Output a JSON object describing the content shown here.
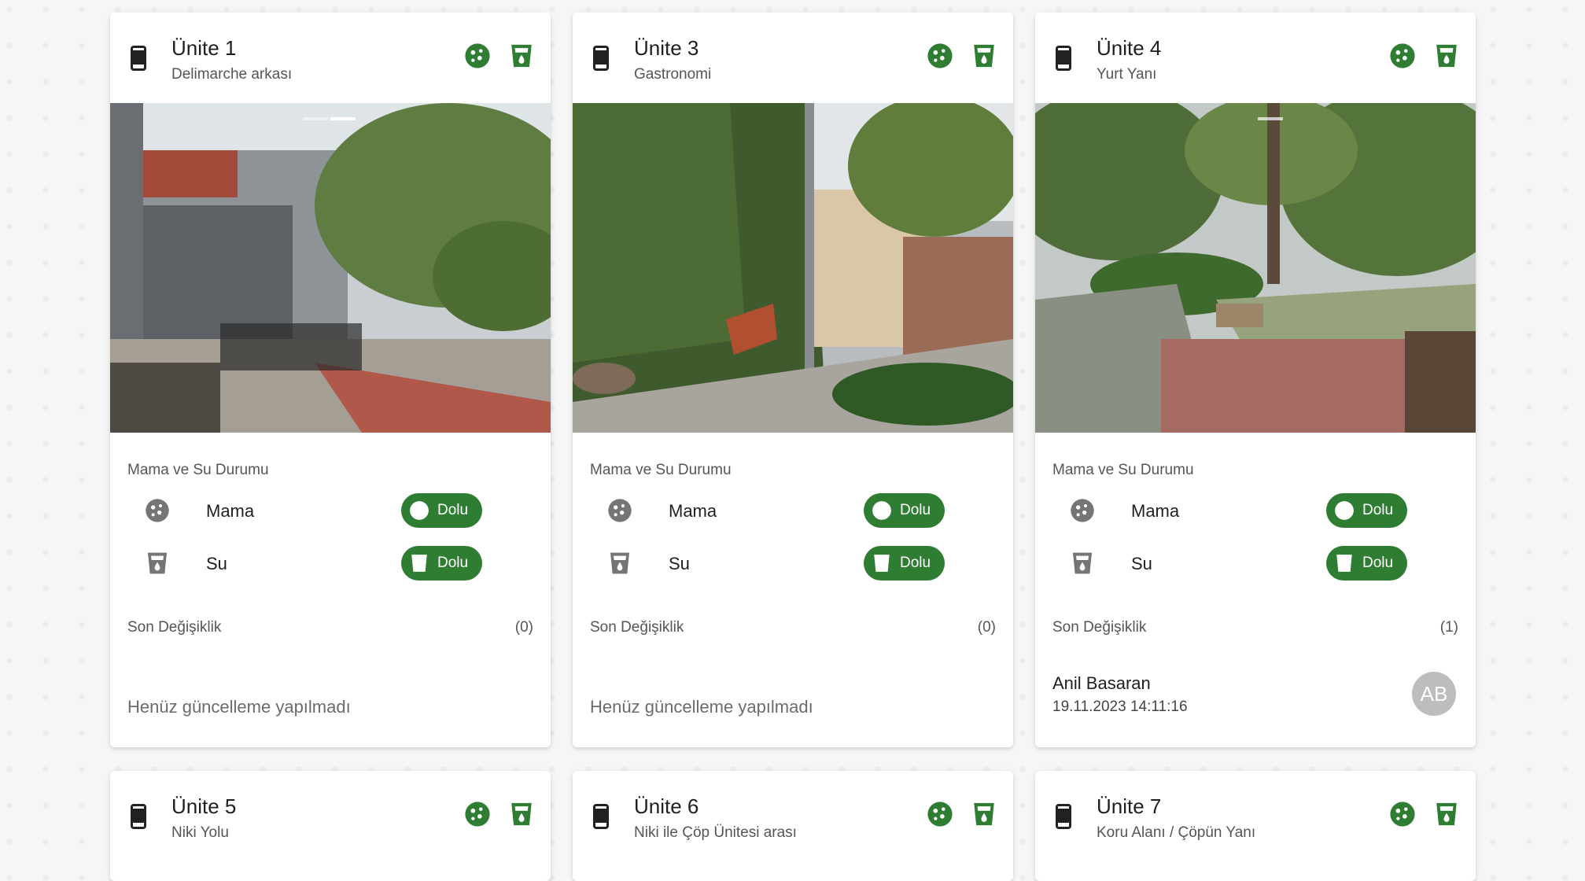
{
  "colors": {
    "accent": "#2e7d32",
    "grey_icon": "#757575"
  },
  "labels": {
    "status_title": "Mama ve Su Durumu",
    "food": "Mama",
    "water": "Su",
    "last_change": "Son Değişiklik",
    "no_update": "Henüz güncelleme yapılmadı"
  },
  "units": [
    {
      "title": "Ünite 1",
      "subtitle": "Delimarche arkası",
      "food_status": "Dolu",
      "water_status": "Dolu",
      "change_count": "(0)"
    },
    {
      "title": "Ünite 3",
      "subtitle": "Gastronomi",
      "food_status": "Dolu",
      "water_status": "Dolu",
      "change_count": "(0)"
    },
    {
      "title": "Ünite 4",
      "subtitle": "Yurt Yanı",
      "food_status": "Dolu",
      "water_status": "Dolu",
      "change_count": "(1)",
      "update": {
        "name": "Anil Basaran",
        "time": "19.11.2023 14:11:16",
        "initials": "AB"
      }
    },
    {
      "title": "Ünite 5",
      "subtitle": "Niki Yolu"
    },
    {
      "title": "Ünite 6",
      "subtitle": "Niki ile Çöp Ünitesi arası"
    },
    {
      "title": "Ünite 7",
      "subtitle": "Koru Alanı / Çöpün Yanı"
    }
  ],
  "icons": {
    "unit": "smartphone-icon",
    "food": "cookie-icon",
    "water": "water-cup-icon"
  }
}
